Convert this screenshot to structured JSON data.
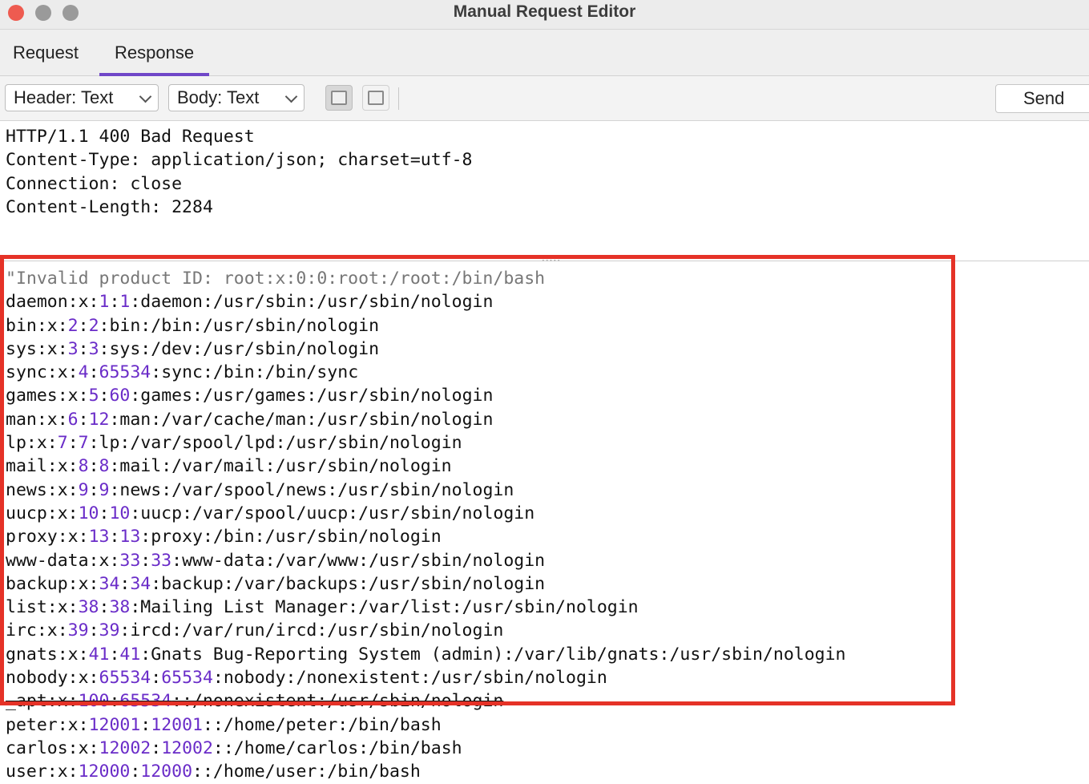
{
  "window": {
    "title": "Manual Request Editor"
  },
  "tabs": [
    {
      "label": "Request",
      "active": false
    },
    {
      "label": "Response",
      "active": true
    }
  ],
  "toolbar": {
    "header_select": "Header: Text",
    "body_select": "Body: Text",
    "send_label": "Send"
  },
  "colors": {
    "accent": "#7047c8",
    "highlight_border": "#e53227",
    "number": "#6a2cc8"
  },
  "response": {
    "headers": [
      "HTTP/1.1 400 Bad Request",
      "Content-Type: application/json; charset=utf-8",
      "Connection: close",
      "Content-Length: 2284"
    ],
    "body_lines": [
      "\"Invalid product ID: root:x:0:0:root:/root:/bin/bash",
      "daemon:x:1:1:daemon:/usr/sbin:/usr/sbin/nologin",
      "bin:x:2:2:bin:/bin:/usr/sbin/nologin",
      "sys:x:3:3:sys:/dev:/usr/sbin/nologin",
      "sync:x:4:65534:sync:/bin:/bin/sync",
      "games:x:5:60:games:/usr/games:/usr/sbin/nologin",
      "man:x:6:12:man:/var/cache/man:/usr/sbin/nologin",
      "lp:x:7:7:lp:/var/spool/lpd:/usr/sbin/nologin",
      "mail:x:8:8:mail:/var/mail:/usr/sbin/nologin",
      "news:x:9:9:news:/var/spool/news:/usr/sbin/nologin",
      "uucp:x:10:10:uucp:/var/spool/uucp:/usr/sbin/nologin",
      "proxy:x:13:13:proxy:/bin:/usr/sbin/nologin",
      "www-data:x:33:33:www-data:/var/www:/usr/sbin/nologin",
      "backup:x:34:34:backup:/var/backups:/usr/sbin/nologin",
      "list:x:38:38:Mailing List Manager:/var/list:/usr/sbin/nologin",
      "irc:x:39:39:ircd:/var/run/ircd:/usr/sbin/nologin",
      "gnats:x:41:41:Gnats Bug-Reporting System (admin):/var/lib/gnats:/usr/sbin/nologin",
      "nobody:x:65534:65534:nobody:/nonexistent:/usr/sbin/nologin",
      "_apt:x:100:65534::/nonexistent:/usr/sbin/nologin",
      "peter:x:12001:12001::/home/peter:/bin/bash",
      "carlos:x:12002:12002::/home/carlos:/bin/bash",
      "user:x:12000:12000::/home/user:/bin/bash"
    ]
  }
}
